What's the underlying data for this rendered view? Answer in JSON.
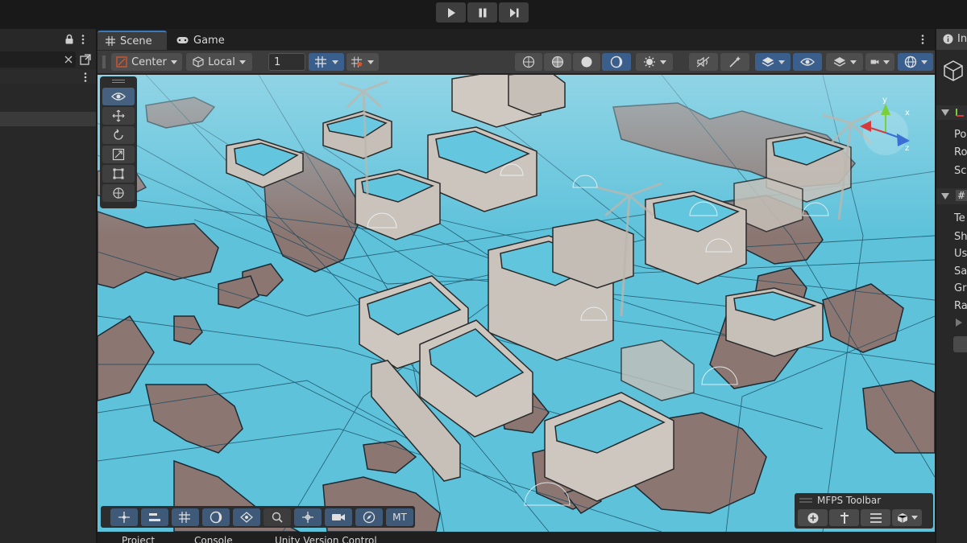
{
  "play_controls": {
    "buttons": [
      {
        "name": "play-button",
        "icon": "play-icon"
      },
      {
        "name": "pause-button",
        "icon": "pause-icon"
      },
      {
        "name": "step-button",
        "icon": "step-icon"
      }
    ]
  },
  "scene_tabs": {
    "scene_label": "Scene",
    "game_label": "Game",
    "scene_icon": "scene-grid-icon",
    "game_icon": "gamepad-icon"
  },
  "scene_toolbar": {
    "pivot_label": "Center",
    "space_label": "Local",
    "grid_value": "1"
  },
  "tools": [
    "view-tool",
    "move-tool",
    "rotate-tool",
    "scale-tool",
    "rect-tool",
    "transform-tool"
  ],
  "bottom_overlay": {
    "mt_label": "MT"
  },
  "mfps_toolbar": {
    "title": "MFPS Toolbar"
  },
  "bottom_panel": {
    "tabs": [
      "Project",
      "Console",
      "Unity Version Control"
    ]
  },
  "inspector": {
    "tab_label": "In",
    "transform_rows": [
      "Po",
      "Ro",
      "Sc"
    ],
    "component_rows": [
      "Te",
      "Sh",
      "Us",
      "Sa",
      "Gr",
      "Ra"
    ],
    "component_header": "#"
  },
  "colors": {
    "accent": "#3a79bb",
    "navmesh": "#5fc3dc",
    "terrain": "#8a7470",
    "building": "#c9c3bb",
    "panel": "#282828"
  }
}
